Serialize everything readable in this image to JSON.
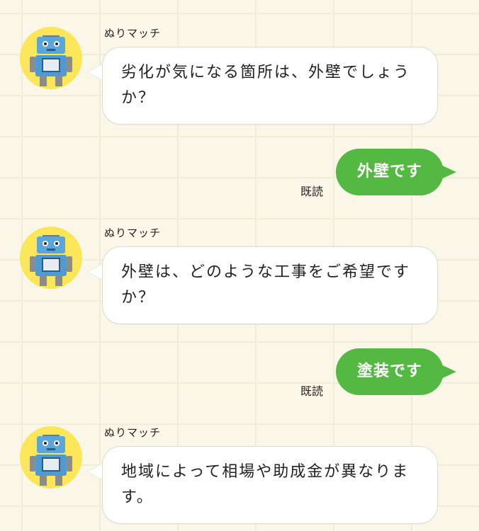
{
  "bot": {
    "name": "ぬりマッチ",
    "avatar_bg": "#fbe65a",
    "avatar_icon": "robot-icon"
  },
  "read_label": "既読",
  "messages": [
    {
      "from": "bot",
      "sender": "ぬりマッチ",
      "text": "劣化が気になる箇所は、外壁でしょうか？"
    },
    {
      "from": "user",
      "text": "外壁です",
      "status": "既読"
    },
    {
      "from": "bot",
      "sender": "ぬりマッチ",
      "text": "外壁は、どのような工事をご希望ですか？"
    },
    {
      "from": "user",
      "text": "塗装です",
      "status": "既読"
    },
    {
      "from": "bot",
      "sender": "ぬりマッチ",
      "text": "地域によって相場や助成金が異なります。"
    }
  ],
  "colors": {
    "user_bubble": "#54b942",
    "bot_bubble": "#ffffff",
    "background": "#fbf7e8"
  }
}
